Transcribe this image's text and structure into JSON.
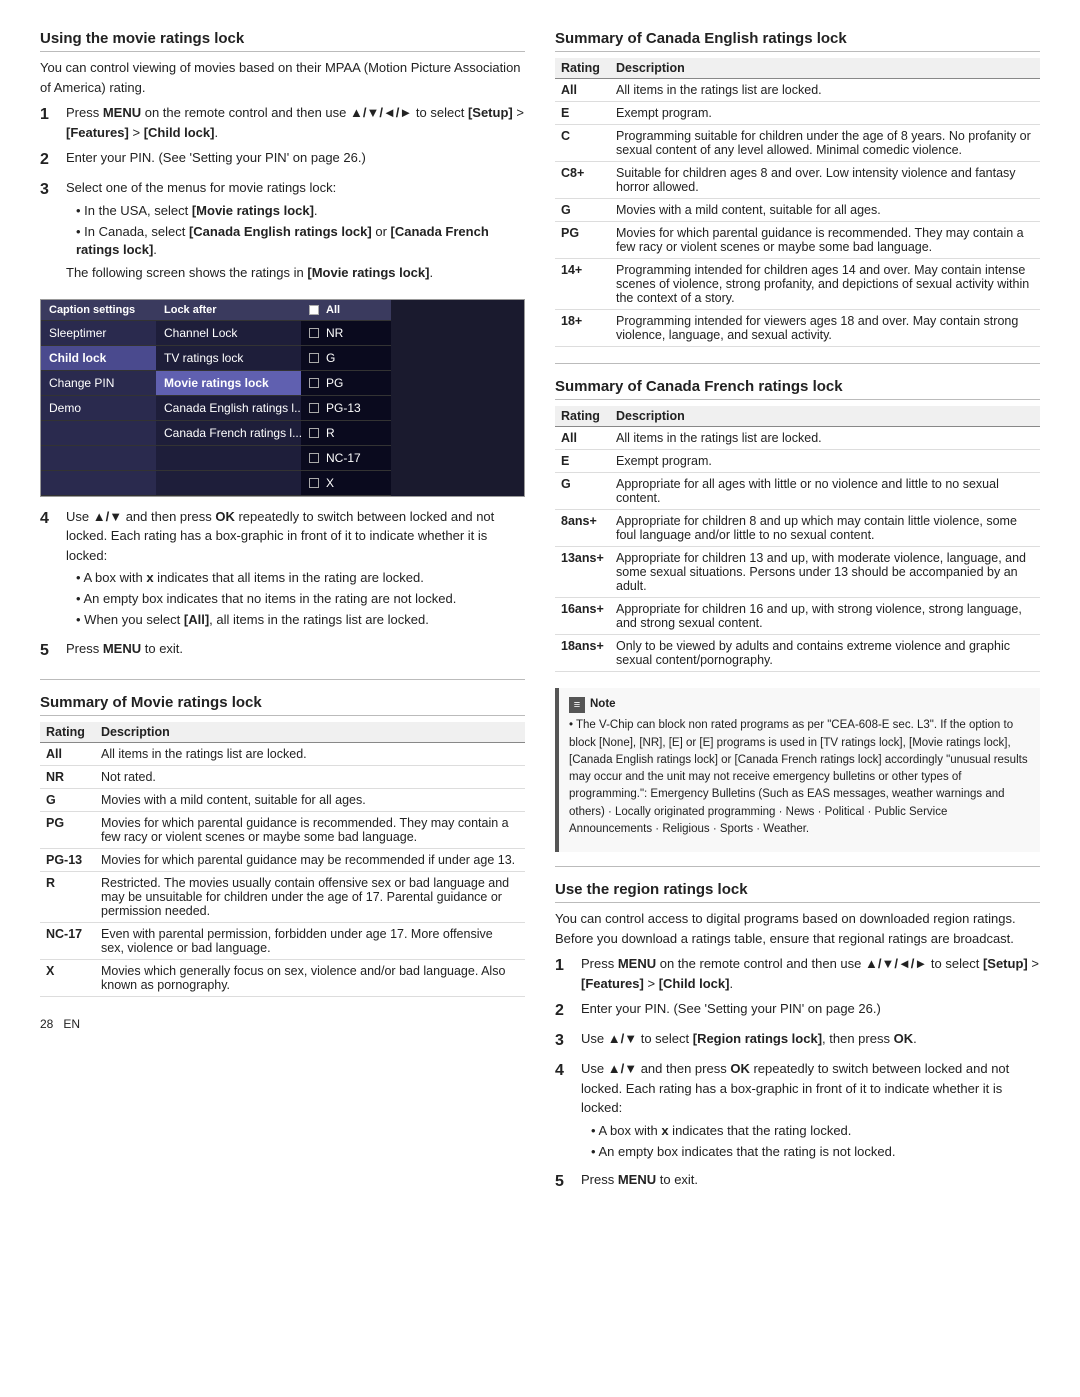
{
  "page": {
    "number": "28",
    "lang": "EN"
  },
  "left": {
    "section1": {
      "title": "Using the movie ratings lock",
      "intro": "You can control viewing of movies based on their MPAA (Motion Picture Association of America) rating.",
      "steps": [
        {
          "num": "1",
          "text": "Press MENU on the remote control and then use ▲/▼/◄/► to select [Setup] > [Features] > [Child lock].",
          "bold_parts": [
            "MENU",
            "▲/▼/◄/►",
            "[Setup]",
            "[Features]",
            "[Child lock]"
          ]
        },
        {
          "num": "2",
          "text": "Enter your PIN. (See 'Setting your PIN' on page 26.)"
        },
        {
          "num": "3",
          "text": "Select one of the menus for movie ratings lock:",
          "bullets": [
            "In the USA, select [Movie ratings lock].",
            "In Canada, select [Canada English ratings lock] or [Canada French ratings lock].",
            "The following screen shows the ratings in [Movie ratings lock]."
          ]
        }
      ],
      "step4": {
        "num": "4",
        "text": "Use ▲/▼ and then press OK repeatedly to switch between locked and not locked. Each rating has a box-graphic in front of it to indicate whether it is locked:",
        "bullets": [
          "A box with x indicates that all items in the rating are locked.",
          "An empty box indicates that no items in the rating are not locked.",
          "When you select [All], all items in the ratings list are locked."
        ]
      },
      "step5": {
        "num": "5",
        "text": "Press MENU to exit."
      }
    },
    "tvMenu": {
      "col1": {
        "header": "Caption settings",
        "rows": [
          {
            "label": "Sleeptimer",
            "selected": false
          },
          {
            "label": "Child lock",
            "selected": true
          },
          {
            "label": "Change PIN",
            "selected": false
          },
          {
            "label": "Demo",
            "selected": false
          }
        ]
      },
      "col2": {
        "header": "Lock after",
        "rows": [
          {
            "label": "Channel Lock",
            "selected": false
          },
          {
            "label": "TV ratings lock",
            "selected": false
          },
          {
            "label": "Movie ratings lock",
            "selected": true,
            "highlighted": true
          },
          {
            "label": "Canada English ratings l...",
            "selected": false
          },
          {
            "label": "Canada French ratings l...",
            "selected": false
          }
        ]
      },
      "col3": {
        "header": "All",
        "rows": [
          {
            "label": "NR",
            "checked": false
          },
          {
            "label": "G",
            "checked": false
          },
          {
            "label": "PG",
            "checked": false
          },
          {
            "label": "PG-13",
            "checked": false
          },
          {
            "label": "R",
            "checked": false
          },
          {
            "label": "NC-17",
            "checked": false
          },
          {
            "label": "X",
            "checked": false
          }
        ]
      }
    },
    "section2": {
      "title": "Summary of Movie ratings lock",
      "table": {
        "headers": [
          "Rating",
          "Description"
        ],
        "rows": [
          {
            "rating": "All",
            "desc": "All items in the ratings list are locked."
          },
          {
            "rating": "NR",
            "desc": "Not rated."
          },
          {
            "rating": "G",
            "desc": "Movies with a mild content, suitable for all ages."
          },
          {
            "rating": "PG",
            "desc": "Movies for which parental guidance is recommended. They may contain a few racy or violent scenes or maybe some bad language."
          },
          {
            "rating": "PG-13",
            "desc": "Movies for which parental guidance may be recommended if under age 13."
          },
          {
            "rating": "R",
            "desc": "Restricted. The movies usually contain offensive sex or bad language and may be unsuitable for children under the age of 17. Parental guidance or permission needed."
          },
          {
            "rating": "NC-17",
            "desc": "Even with parental permission, forbidden under age 17. More offensive sex, violence or bad language."
          },
          {
            "rating": "X",
            "desc": "Movies which generally focus on sex, violence and/or bad language. Also known as pornography."
          }
        ]
      }
    }
  },
  "right": {
    "section1": {
      "title": "Summary of Canada English ratings lock",
      "table": {
        "headers": [
          "Rating",
          "Description"
        ],
        "rows": [
          {
            "rating": "All",
            "desc": "All items in the ratings list are locked."
          },
          {
            "rating": "E",
            "desc": "Exempt program."
          },
          {
            "rating": "C",
            "desc": "Programming suitable for children under the age of 8 years. No profanity or sexual content of any level allowed. Minimal comedic violence."
          },
          {
            "rating": "C8+",
            "desc": "Suitable for children ages 8 and over. Low intensity violence and fantasy horror allowed."
          },
          {
            "rating": "G",
            "desc": "Movies with a mild content, suitable for all ages."
          },
          {
            "rating": "PG",
            "desc": "Movies for which parental guidance is recommended. They may contain a few racy or violent scenes or maybe some bad language."
          },
          {
            "rating": "14+",
            "desc": "Programming intended for children ages 14 and over. May contain intense scenes of violence, strong profanity, and depictions of sexual activity within the context of a story."
          },
          {
            "rating": "18+",
            "desc": "Programming intended for viewers ages 18 and over. May contain strong violence, language, and sexual activity."
          }
        ]
      }
    },
    "section2": {
      "title": "Summary of Canada French ratings lock",
      "table": {
        "headers": [
          "Rating",
          "Description"
        ],
        "rows": [
          {
            "rating": "All",
            "desc": "All items in the ratings list are locked."
          },
          {
            "rating": "E",
            "desc": "Exempt program."
          },
          {
            "rating": "G",
            "desc": "Appropriate for all ages with little or no violence and little to no sexual content."
          },
          {
            "rating": "8ans+",
            "desc": "Appropriate for children 8 and up which may contain little violence, some foul language and/or little to no sexual content."
          },
          {
            "rating": "13ans+",
            "desc": "Appropriate for children 13 and up, with moderate violence, language, and some sexual situations. Persons under 13 should be accompanied by an adult."
          },
          {
            "rating": "16ans+",
            "desc": "Appropriate for children 16 and up, with strong violence, strong language, and strong sexual content."
          },
          {
            "rating": "18ans+",
            "desc": "Only to be viewed by adults and contains extreme violence and graphic sexual content/pornography."
          }
        ]
      }
    },
    "note": {
      "title": "Note",
      "text": "The V-Chip can block non rated programs as per \"CEA-608-E sec. L3\". If the option to block [None], [NR], [E] or [E] programs is used in [TV ratings lock], [Movie ratings lock], [Canada English ratings lock] or [Canada French ratings lock] accordingly \"unusual results may occur and the unit may not receive emergency bulletins or other types of programming.\": Emergency Bulletins (Such as EAS messages, weather warnings and others) · Locally originated programming · News · Political · Public Service Announcements · Religious · Sports · Weather."
    },
    "section3": {
      "title": "Use the region ratings lock",
      "intro": "You can control access to digital programs based on downloaded region ratings. Before you download a ratings table, ensure that regional ratings are broadcast.",
      "steps": [
        {
          "num": "1",
          "text": "Press MENU on the remote control and then use ▲/▼/◄/► to select [Setup] > [Features] > [Child lock]."
        },
        {
          "num": "2",
          "text": "Enter your PIN. (See 'Setting your PIN' on page 26.)"
        },
        {
          "num": "3",
          "text": "Use ▲/▼ to select [Region ratings lock], then press OK."
        },
        {
          "num": "4",
          "text": "Use ▲/▼ and then press OK repeatedly to switch between locked and not locked. Each rating has a box-graphic in front of it to indicate whether it is locked:",
          "bullets": [
            "A box with x indicates that the rating locked.",
            "An empty box indicates that the rating is not locked."
          ]
        },
        {
          "num": "5",
          "text": "Press MENU to exit."
        }
      ]
    }
  }
}
